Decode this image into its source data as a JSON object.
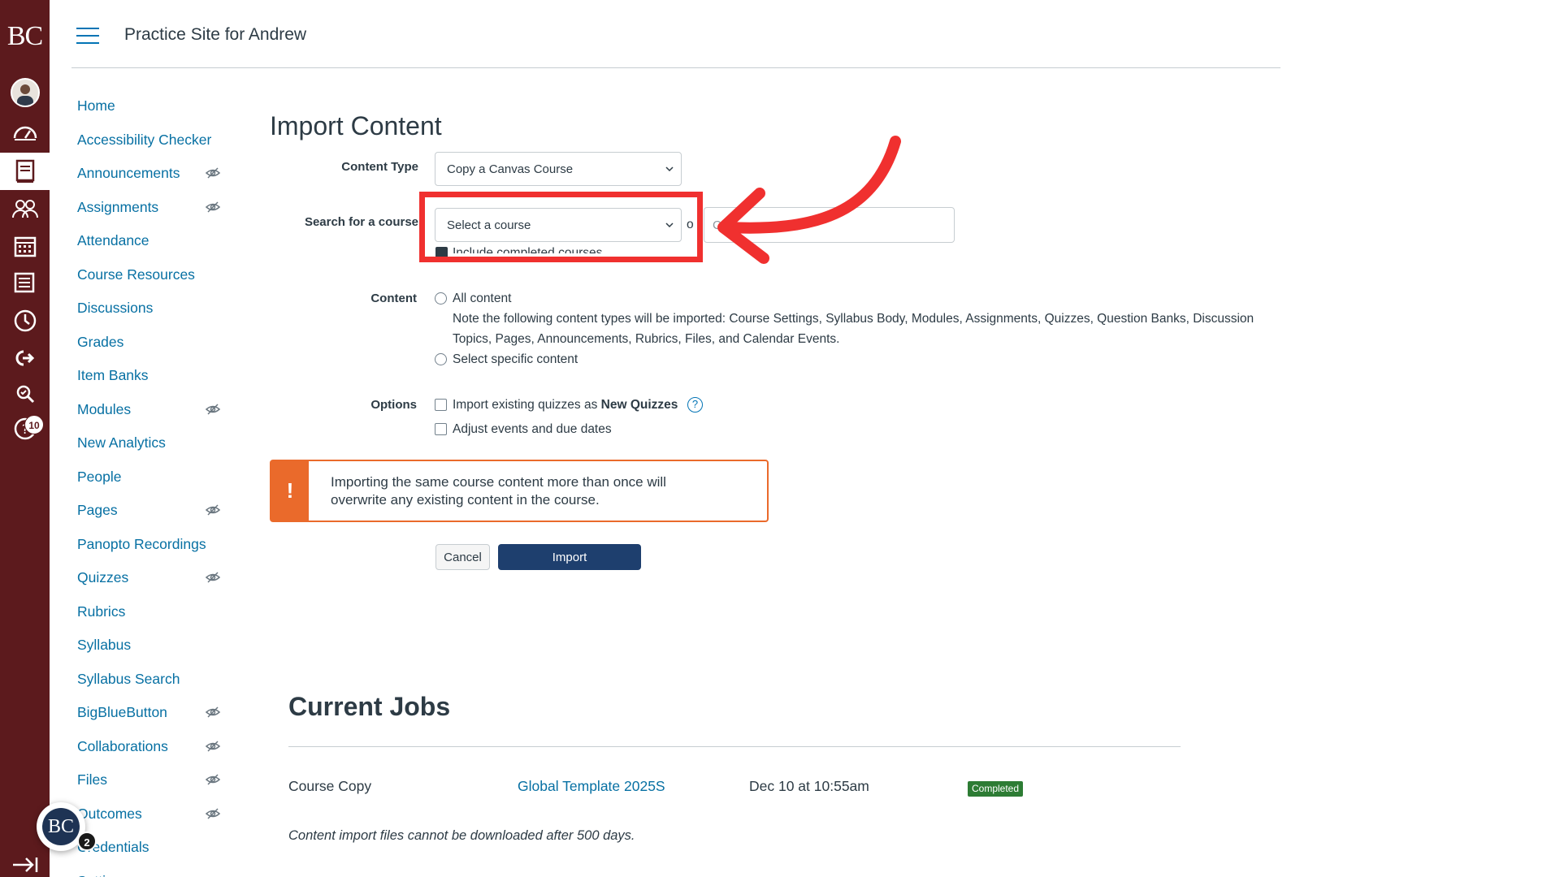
{
  "global_nav": {
    "logo_text": "BC",
    "items": [
      "account-avatar",
      "dashboard-icon",
      "courses-icon",
      "groups-icon",
      "calendar-icon",
      "inbox-icon",
      "history-icon",
      "external-tool-icon",
      "commons-icon",
      "help-icon"
    ],
    "help_badge": "10",
    "bg_color": "#5c1a1d"
  },
  "header": {
    "site_title": "Practice Site for Andrew"
  },
  "course_nav": {
    "items": [
      {
        "label": "Home",
        "hidden": false
      },
      {
        "label": "Accessibility Checker",
        "hidden": false
      },
      {
        "label": "Announcements",
        "hidden": true
      },
      {
        "label": "Assignments",
        "hidden": true
      },
      {
        "label": "Attendance",
        "hidden": false
      },
      {
        "label": "Course Resources",
        "hidden": false
      },
      {
        "label": "Discussions",
        "hidden": false
      },
      {
        "label": "Grades",
        "hidden": false
      },
      {
        "label": "Item Banks",
        "hidden": false
      },
      {
        "label": "Modules",
        "hidden": true
      },
      {
        "label": "New Analytics",
        "hidden": false
      },
      {
        "label": "People",
        "hidden": false
      },
      {
        "label": "Pages",
        "hidden": true
      },
      {
        "label": "Panopto Recordings",
        "hidden": false
      },
      {
        "label": "Quizzes",
        "hidden": true
      },
      {
        "label": "Rubrics",
        "hidden": false
      },
      {
        "label": "Syllabus",
        "hidden": false
      },
      {
        "label": "Syllabus Search",
        "hidden": false
      },
      {
        "label": "BigBlueButton",
        "hidden": true
      },
      {
        "label": "Collaborations",
        "hidden": true
      },
      {
        "label": "Files",
        "hidden": true
      },
      {
        "label": "Outcomes",
        "hidden": true
      },
      {
        "label": "Credentials",
        "hidden": false
      },
      {
        "label": "Settings",
        "hidden": false
      }
    ]
  },
  "import": {
    "heading": "Import Content",
    "content_type_label": "Content Type",
    "content_type_value": "Copy a Canvas Course",
    "search_label": "Search for a course",
    "search_select_value": "Select a course",
    "search_or": "o",
    "search_input_placeholder": "C",
    "include_completed_label": "Include completed courses",
    "content_label": "Content",
    "all_content_label": "All content",
    "all_content_note_line1": "Note the following content types will be imported: Course Settings, Syllabus Body, Modules, Assignments, Quizzes, Question Banks, Discussion",
    "all_content_note_line2": "Topics, Pages, Announcements, Rubrics, Files, and Calendar Events.",
    "specific_content_label": "Select specific content",
    "options_label": "Options",
    "option_quizzes_prefix": "Import existing quizzes as ",
    "option_quizzes_bold": "New Quizzes",
    "option_dates_label": "Adjust events and due dates",
    "help_glyph": "?",
    "warning_icon": "!",
    "warning_line1": "Importing the same course content more than once will",
    "warning_line2": "overwrite any existing content in the course.",
    "cancel_label": "Cancel",
    "import_label": "Import"
  },
  "jobs": {
    "heading": "Current Jobs",
    "rows": [
      {
        "type": "Course Copy",
        "source": "Global Template 2025S",
        "date": "Dec 10 at 10:55am",
        "status": "Completed"
      }
    ],
    "note": "Content import files cannot be downloaded after 500 days."
  },
  "floating_avatar": {
    "text": "BC",
    "badge": "2"
  },
  "colors": {
    "link": "#0770a3",
    "warning": "#ea6a2b",
    "primary_button": "#1e3f6e",
    "annotation": "#f0302f",
    "success": "#2d7c34"
  }
}
